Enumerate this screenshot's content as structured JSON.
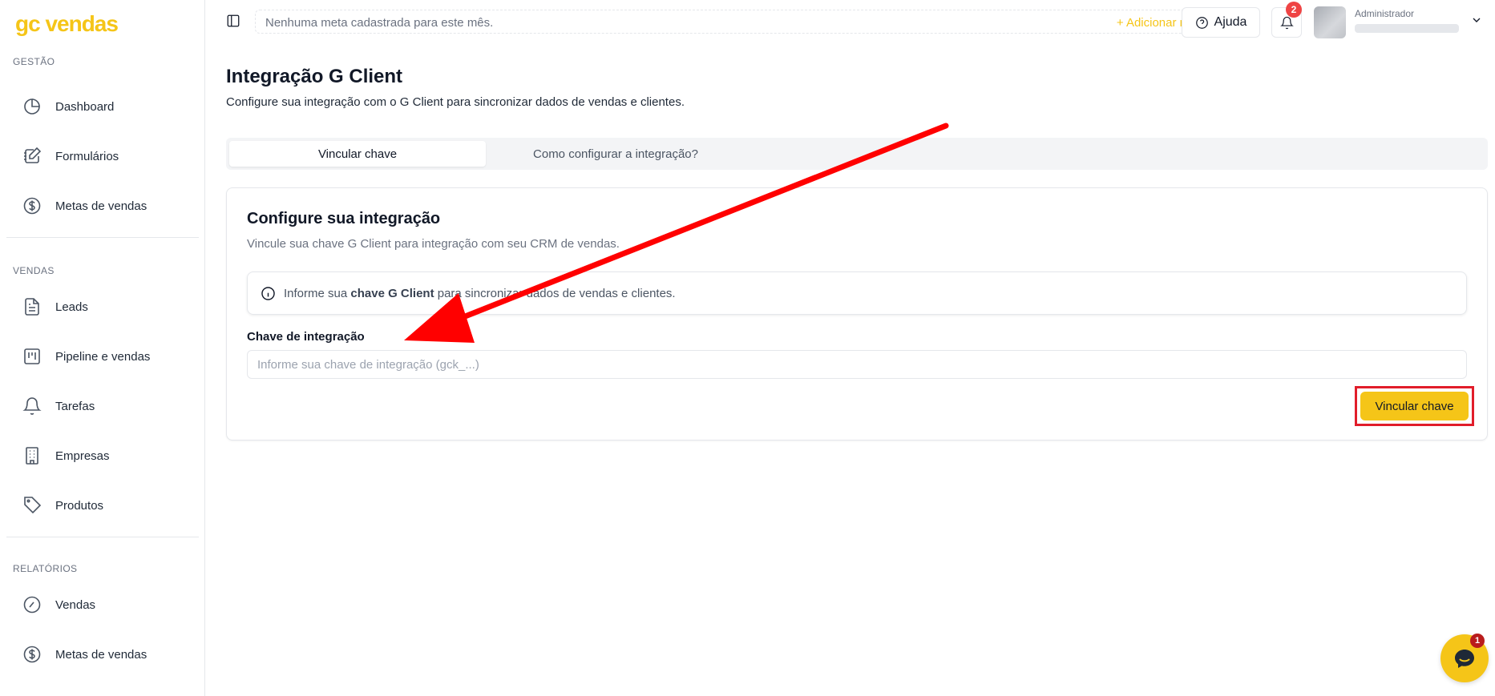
{
  "brand": {
    "logo_text": "gc vendas",
    "accent_color": "#f5c518"
  },
  "sidebar": {
    "sections": [
      {
        "label": "GESTÃO",
        "items": [
          {
            "label": "Dashboard",
            "icon": "pie-chart-icon"
          },
          {
            "label": "Formulários",
            "icon": "form-edit-icon"
          },
          {
            "label": "Metas de vendas",
            "icon": "dollar-circle-icon"
          }
        ]
      },
      {
        "label": "VENDAS",
        "items": [
          {
            "label": "Leads",
            "icon": "document-icon"
          },
          {
            "label": "Pipeline e vendas",
            "icon": "kanban-icon"
          },
          {
            "label": "Tarefas",
            "icon": "bell-icon"
          },
          {
            "label": "Empresas",
            "icon": "building-icon"
          },
          {
            "label": "Produtos",
            "icon": "tag-icon"
          }
        ]
      },
      {
        "label": "RELATÓRIOS",
        "items": [
          {
            "label": "Vendas",
            "icon": "gauge-icon"
          },
          {
            "label": "Metas de vendas",
            "icon": "dollar-circle-icon"
          }
        ]
      }
    ]
  },
  "topbar": {
    "goal_text": "Nenhuma meta cadastrada para este mês.",
    "add_goal_label": "+ Adicionar meta",
    "help_label": "Ajuda",
    "notification_count": "2",
    "user_role": "Administrador"
  },
  "page": {
    "title": "Integração G Client",
    "subtitle": "Configure sua integração com o G Client para sincronizar dados de vendas e clientes.",
    "tabs": [
      {
        "label": "Vincular chave",
        "active": true
      },
      {
        "label": "Como configurar a integração?",
        "active": false
      }
    ]
  },
  "card": {
    "title": "Configure sua integração",
    "subtitle": "Vincule sua chave G Client para integração com seu CRM de vendas.",
    "alert_prefix": "Informe sua ",
    "alert_bold": "chave G Client",
    "alert_suffix": " para sincronizar dados de vendas e clientes.",
    "field_label": "Chave de integração",
    "field_value": "",
    "field_placeholder": "Informe sua chave de integração (gck_...)",
    "submit_label": "Vincular chave"
  },
  "annotation": {
    "highlight_color": "#e11d2a",
    "arrow_color": "#ff0000"
  },
  "chat": {
    "badge_count": "1"
  }
}
